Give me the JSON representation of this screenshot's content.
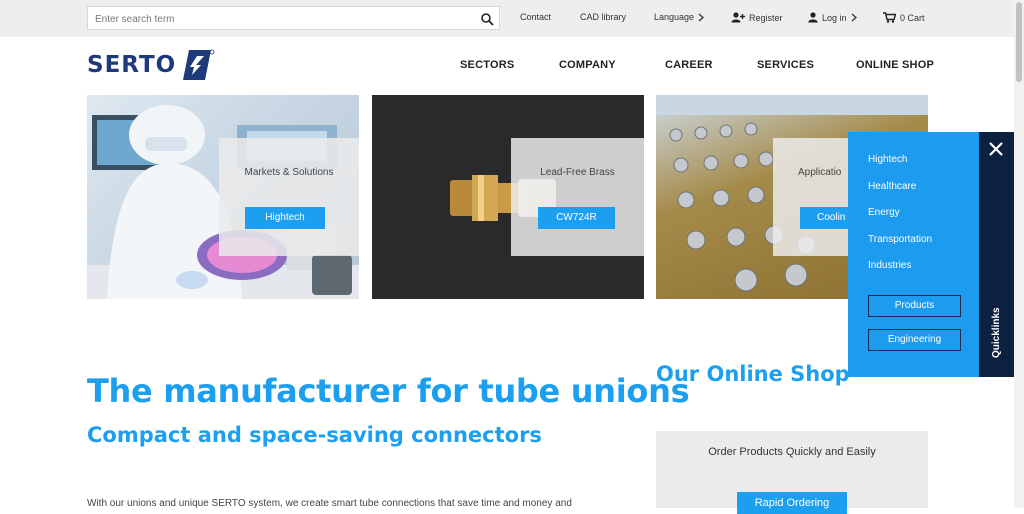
{
  "topbar": {
    "search_placeholder": "Enter search term",
    "contact": "Contact",
    "cad_library": "CAD library",
    "language": "Language",
    "register": "Register",
    "login": "Log in",
    "cart": "0 Cart"
  },
  "header": {
    "logo_text": "SERTO",
    "nav": [
      "SECTORS",
      "COMPANY",
      "CAREER",
      "SERVICES",
      "ONLINE SHOP"
    ]
  },
  "tiles": [
    {
      "label": "Markets & Solutions",
      "button": "Hightech"
    },
    {
      "label": "Lead-Free Brass",
      "button": "CW724R"
    },
    {
      "label": "Applicatio",
      "button": "Coolin"
    }
  ],
  "quicklinks": {
    "items": [
      "Hightech",
      "Healthcare",
      "Energy",
      "Transportation",
      "Industries"
    ],
    "buttons": [
      "Products",
      "Engineering"
    ],
    "tab_label": "Quicklinks"
  },
  "main": {
    "title": "The manufacturer for tube unions",
    "subtitle": "Compact and space-saving connectors",
    "body": "With our unions and unique SERTO system, we create smart tube connections that save time and money and"
  },
  "shop": {
    "heading": "Our Online Shop",
    "text": "Order Products Quickly and Easily",
    "button": "Rapid Ordering"
  },
  "colors": {
    "accent": "#1d9ff0",
    "dark_navy": "#0c2140",
    "logo_navy": "#1e3a7a"
  }
}
